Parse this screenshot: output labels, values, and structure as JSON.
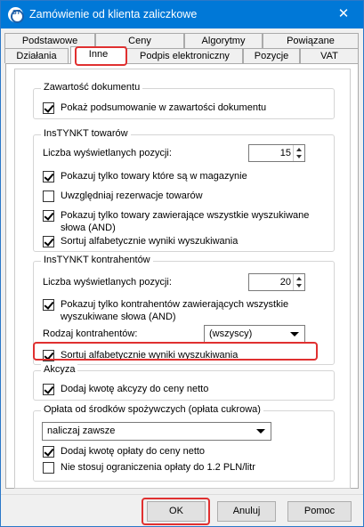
{
  "window": {
    "title": "Zamówienie od klienta zaliczkowe",
    "close_glyph": "✕",
    "icon": "app-logo-icon",
    "icon_text": "ST"
  },
  "tabs_row1": [
    "Podstawowe",
    "Ceny",
    "Algorytmy",
    "Powiązane"
  ],
  "tabs_row2": [
    "Działania",
    "Inne",
    "Podpis elektroniczny",
    "Pozycje",
    "VAT"
  ],
  "active_tab": "Inne",
  "sections": {
    "zawartosc": {
      "title": "Zawartość dokumentu",
      "show_summary": {
        "label": "Pokaż podsumowanie w zawartości dokumentu",
        "checked": true
      }
    },
    "instynkt_towary": {
      "title": "InsTYNKT towarów",
      "count_label": "Liczba wyświetlanych pozycji:",
      "count_value": "15",
      "only_in_stock": {
        "label": "Pokazuj tylko towary które są w magazynie",
        "checked": true
      },
      "reservations": {
        "label": "Uwzględniaj rezerwacje towarów",
        "checked": false
      },
      "all_words": {
        "label": "Pokazuj tylko towary zawierające wszystkie wyszukiwane słowa (AND)",
        "checked": true
      },
      "sort": {
        "label": "Sortuj alfabetycznie wyniki wyszukiwania",
        "checked": true
      }
    },
    "instynkt_kontrahenci": {
      "title": "InsTYNKT kontrahentów",
      "count_label": "Liczba wyświetlanych pozycji:",
      "count_value": "20",
      "all_words": {
        "label": "Pokazuj tylko kontrahentów zawierających wszystkie wyszukiwane słowa (AND)",
        "checked": true
      },
      "type_label": "Rodzaj kontrahentów:",
      "type_value": "(wszyscy)",
      "sort": {
        "label": "Sortuj alfabetycznie wyniki wyszukiwania",
        "checked": true
      }
    },
    "akcyza": {
      "title": "Akcyza",
      "add": {
        "label": "Dodaj kwotę akcyzy do ceny netto",
        "checked": true
      }
    },
    "oplata": {
      "title": "Opłata od środków spożywczych (opłata cukrowa)",
      "mode_value": "naliczaj zawsze",
      "add": {
        "label": "Dodaj kwotę opłaty do ceny netto",
        "checked": true
      },
      "no_limit": {
        "label": "Nie stosuj ograniczenia opłaty do 1.2 PLN/litr",
        "checked": false
      }
    }
  },
  "buttons": {
    "ok": "OK",
    "cancel": "Anuluj",
    "help": "Pomoc"
  },
  "highlight_color": "#e03030",
  "titlebar_color": "#0078d7"
}
